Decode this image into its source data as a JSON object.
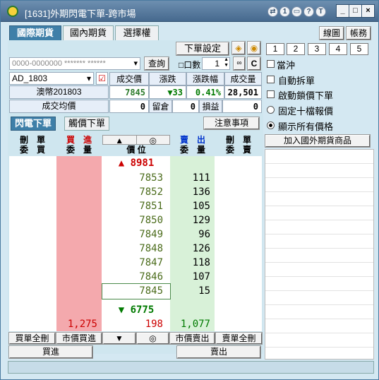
{
  "window": {
    "title": "[1631]外期閃電下單-跨市場"
  },
  "titlebar": {
    "icons": [
      "arrows-icon",
      "info-icon",
      "window-icon",
      "help-icon",
      "t-icon"
    ],
    "buttons": [
      "_",
      "□",
      "×"
    ]
  },
  "tabs": [
    "國際期貨",
    "國內期貨",
    "選擇權"
  ],
  "top_right_buttons": {
    "chart": "線圖",
    "account": "帳務"
  },
  "order_settings_button": "下單設定",
  "account_select": "0000-0000000 ******* ******",
  "query_button": "查詢",
  "qty": {
    "label": "口數",
    "value": "1"
  },
  "c_button": "C",
  "number_buttons": [
    "1",
    "2",
    "3",
    "4",
    "5"
  ],
  "checkboxes": [
    {
      "label": "當沖",
      "checked": false
    },
    {
      "label": "自動拆單",
      "checked": false
    },
    {
      "label": "啟動鎖價下單",
      "checked": false
    }
  ],
  "radios": [
    {
      "label": "固定十檔報價",
      "selected": false
    },
    {
      "label": "顯示所有價格",
      "selected": true
    }
  ],
  "add_product_button": "加入國外期貨商品",
  "symbol_select": "AD_1803",
  "product_name": "澳幣201803",
  "quote_headers": [
    "成交價",
    "漲跌",
    "漲跌幅",
    "成交量"
  ],
  "quote": {
    "last": "7845",
    "change": "▼33",
    "change_pct": "0.41%",
    "volume": "28,501"
  },
  "avg_row": {
    "label": "成交均價",
    "avg": "0",
    "hold_label": "留倉",
    "hold": "0",
    "pl_label": "損益",
    "pl": "0"
  },
  "order_tabs": [
    "閃電下單",
    "觸價下單"
  ],
  "notes_button": "注意事項",
  "ladder_headers": {
    "del_buy": "刪 單\n委 買",
    "buy": "買 進\n委 量",
    "price": "價 位",
    "sell": "賣 出\n委 量",
    "del_sell": "刪 單\n委 賣",
    "up": "▲",
    "center": "◎"
  },
  "high_price": "8981",
  "low_price": "6775",
  "ladder": [
    {
      "price": "7853",
      "ask": "111"
    },
    {
      "price": "7852",
      "ask": "136"
    },
    {
      "price": "7851",
      "ask": "105"
    },
    {
      "price": "7850",
      "ask": "129"
    },
    {
      "price": "7849",
      "ask": "96"
    },
    {
      "price": "7848",
      "ask": "126"
    },
    {
      "price": "7847",
      "ask": "118"
    },
    {
      "price": "7846",
      "ask": "107"
    },
    {
      "price": "7845",
      "ask": "15"
    }
  ],
  "totals": {
    "bid": "1,275",
    "diff": "198",
    "ask": "1,077"
  },
  "bottom_buttons": [
    "買單全刪",
    "市價買進",
    "▼",
    "◎",
    "市價賣出",
    "賣單全刪"
  ],
  "action_buttons": {
    "buy": "買進",
    "sell": "賣出"
  },
  "colors": {
    "bid_bg": "#f4a9ad",
    "ask_bg": "#d8f1d8",
    "up": "#d00000",
    "down": "#007a00",
    "tab_active": "#3f7fa8"
  }
}
